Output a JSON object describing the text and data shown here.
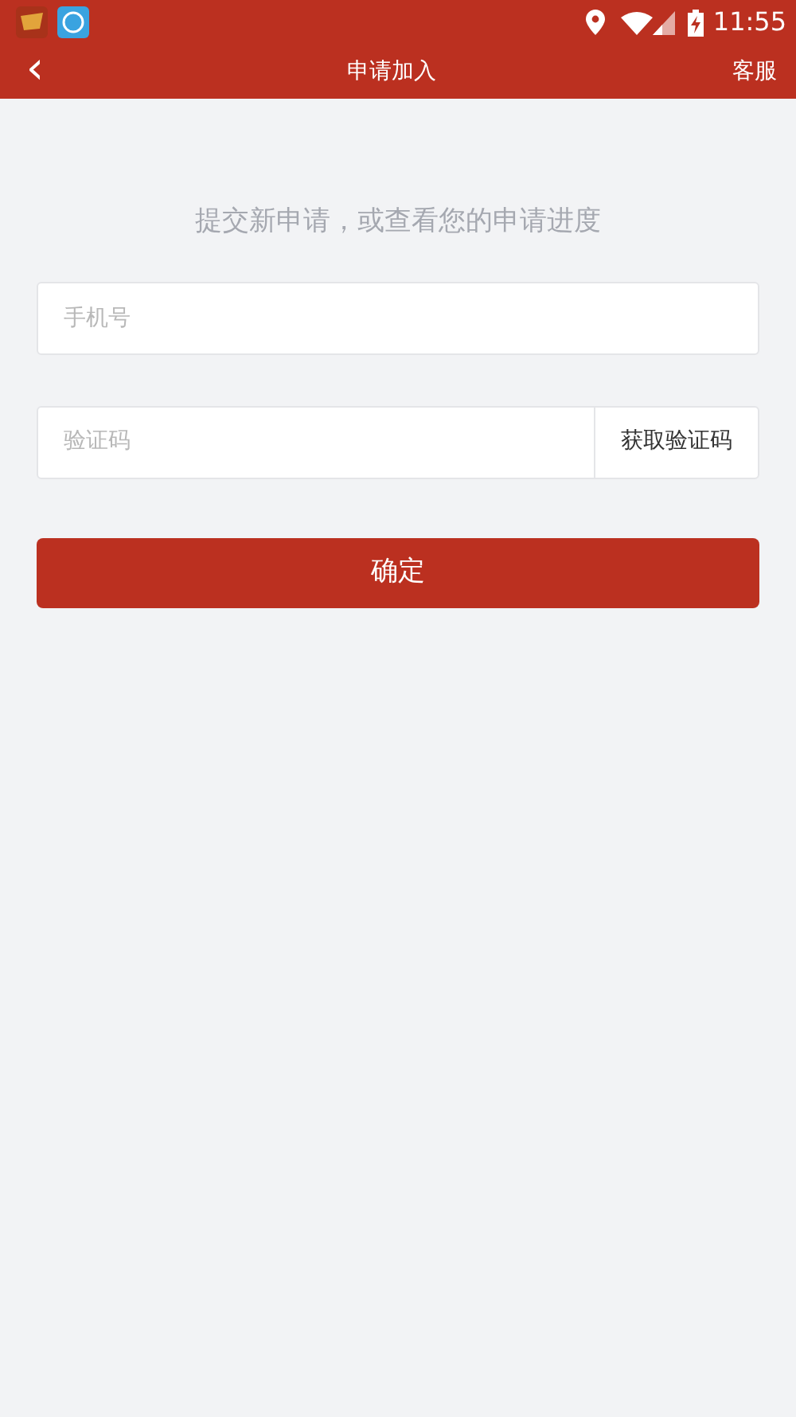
{
  "status_bar": {
    "time": "11:55"
  },
  "header": {
    "back": "‹",
    "title": "申请加入",
    "action": "客服"
  },
  "intro": "提交新申请，或查看您的申请进度",
  "phone_field": {
    "placeholder": "手机号"
  },
  "code_field": {
    "placeholder": "验证码",
    "button": "获取验证码"
  },
  "submit": "确定"
}
